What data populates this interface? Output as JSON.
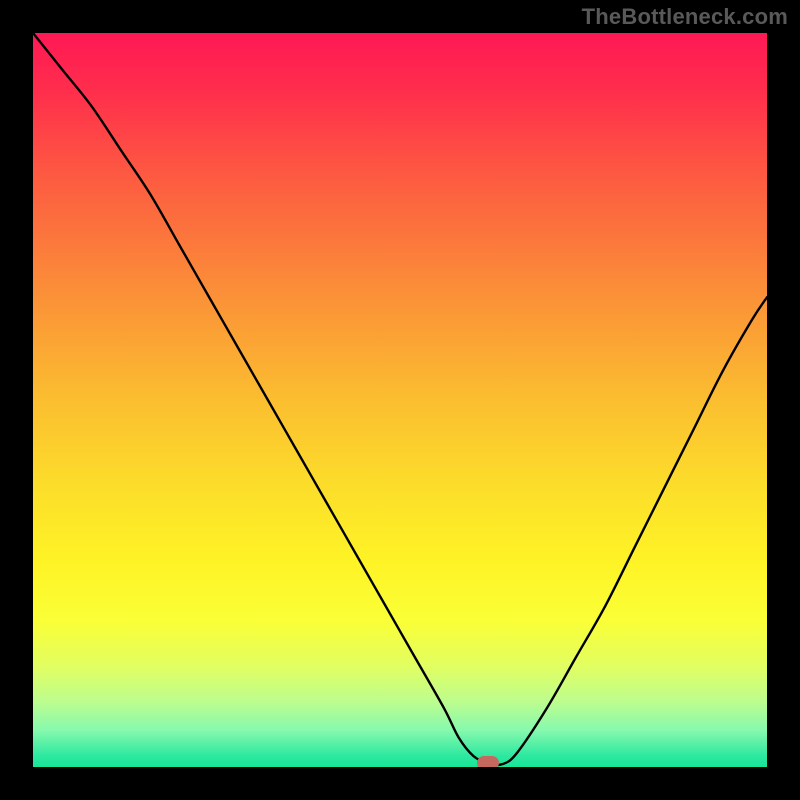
{
  "watermark": "TheBottleneck.com",
  "colors": {
    "frame": "#000000",
    "watermark_text": "#595959",
    "curve_stroke": "#000000",
    "marker_fill": "#C5695F",
    "gradient_stops": [
      {
        "offset": 0.0,
        "color": "#FF1955"
      },
      {
        "offset": 0.08,
        "color": "#FF2E4C"
      },
      {
        "offset": 0.2,
        "color": "#FD5C41"
      },
      {
        "offset": 0.35,
        "color": "#FB8E38"
      },
      {
        "offset": 0.5,
        "color": "#FBBE30"
      },
      {
        "offset": 0.62,
        "color": "#FCDE2A"
      },
      {
        "offset": 0.72,
        "color": "#FEF326"
      },
      {
        "offset": 0.8,
        "color": "#FAFF36"
      },
      {
        "offset": 0.86,
        "color": "#E3FE5F"
      },
      {
        "offset": 0.91,
        "color": "#BEFD8D"
      },
      {
        "offset": 0.95,
        "color": "#86F9AE"
      },
      {
        "offset": 0.985,
        "color": "#2DE8A0"
      },
      {
        "offset": 1.0,
        "color": "#16E597"
      }
    ]
  },
  "chart_data": {
    "type": "line",
    "title": "",
    "xlabel": "",
    "ylabel": "",
    "xlim": [
      0,
      100
    ],
    "ylim": [
      0,
      100
    ],
    "grid": false,
    "legend": false,
    "x": [
      0,
      4,
      8,
      12,
      16,
      20,
      24,
      28,
      32,
      36,
      40,
      44,
      48,
      52,
      56,
      58,
      60,
      62,
      64,
      66,
      70,
      74,
      78,
      82,
      86,
      90,
      94,
      98,
      100
    ],
    "values": [
      100,
      95,
      90,
      84,
      78,
      71,
      64,
      57,
      50,
      43,
      36,
      29,
      22,
      15,
      8,
      4,
      1.5,
      0.5,
      0.4,
      2,
      8,
      15,
      22,
      30,
      38,
      46,
      54,
      61,
      64
    ],
    "marker": {
      "x": 62,
      "y": 0.5,
      "color": "#C5695F"
    }
  }
}
